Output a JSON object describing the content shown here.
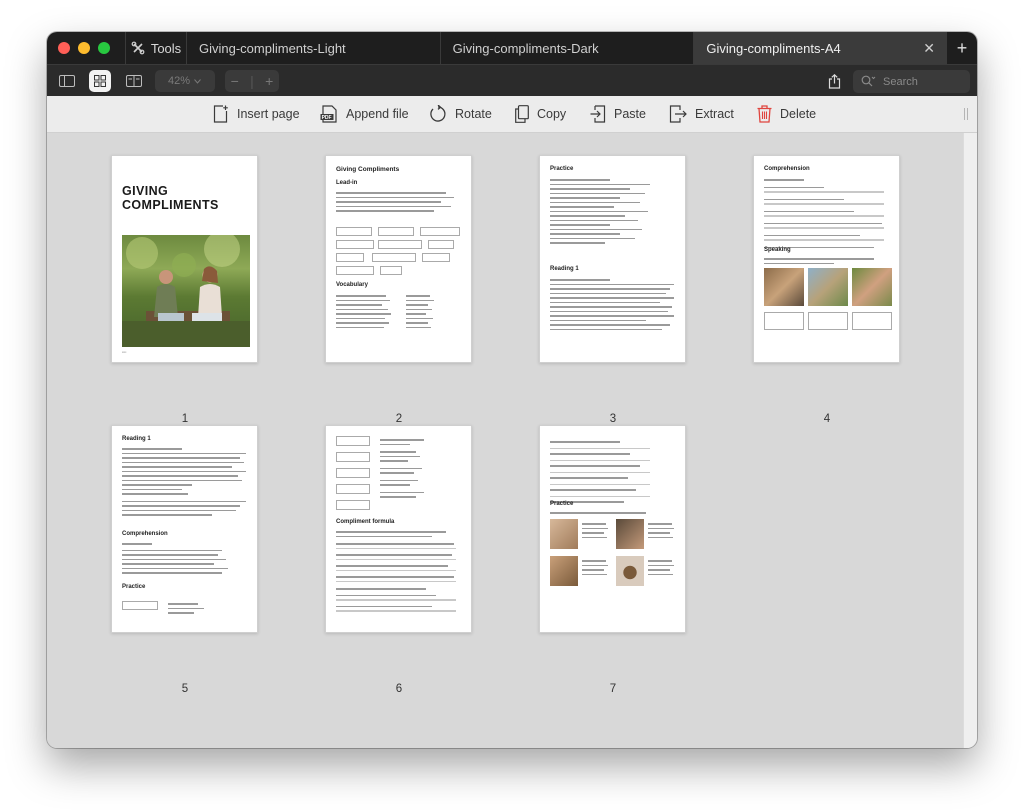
{
  "tabs": {
    "tools_label": "Tools",
    "items": [
      {
        "label": "Giving-compliments-Light"
      },
      {
        "label": "Giving-compliments-Dark"
      },
      {
        "label": "Giving-compliments-A4"
      }
    ],
    "close_symbol": "✕",
    "new_tab_symbol": "+"
  },
  "viewbar": {
    "zoom_value": "42%",
    "zoom_out_symbol": "−",
    "zoom_in_symbol": "+",
    "search_placeholder": "Search"
  },
  "actions": {
    "insert_page": "Insert page",
    "append_file": "Append file",
    "rotate": "Rotate",
    "copy": "Copy",
    "paste": "Paste",
    "extract": "Extract",
    "delete": "Delete"
  },
  "pages": [
    {
      "number": "1",
      "title": "GIVING COMPLIMENTS"
    },
    {
      "number": "2",
      "title": "Giving Compliments",
      "section": "Lead-in",
      "section2": "Vocabulary"
    },
    {
      "number": "3",
      "title": "Practice",
      "section": "Reading 1"
    },
    {
      "number": "4",
      "title": "Comprehension",
      "section": "Speaking"
    },
    {
      "number": "5",
      "title": "Reading 1",
      "section": "Comprehension",
      "section2": "Practice"
    },
    {
      "number": "6",
      "title": "Compliment formula"
    },
    {
      "number": "7",
      "title": "Practice"
    }
  ],
  "colors": {
    "traffic_red": "#ff5f57",
    "traffic_yellow": "#febc2e",
    "traffic_green": "#28c840",
    "delete_red": "#e0443e"
  }
}
